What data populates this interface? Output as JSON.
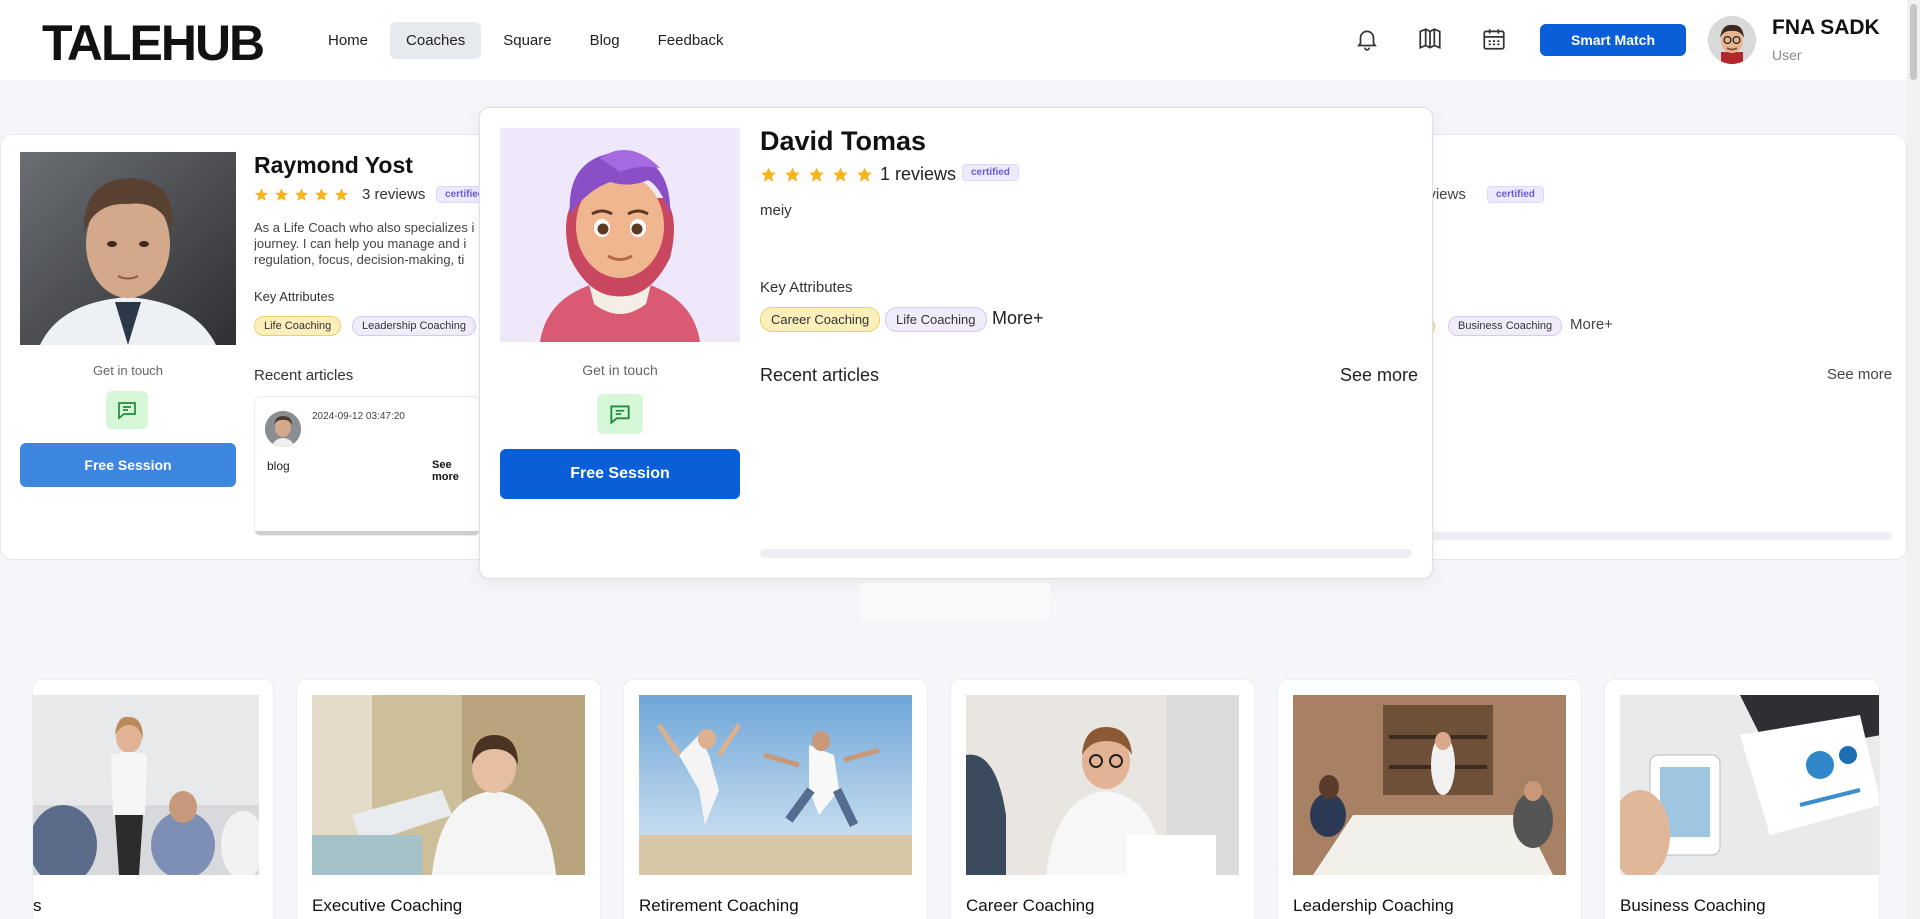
{
  "header": {
    "logo_text": "TALEHUB",
    "nav": [
      {
        "label": "Home"
      },
      {
        "label": "Coaches"
      },
      {
        "label": "Square"
      },
      {
        "label": "Blog"
      },
      {
        "label": "Feedback"
      }
    ],
    "active_nav": "Coaches",
    "icons": [
      "bell-icon",
      "book-icon",
      "calendar-icon"
    ],
    "smart_match_label": "Smart Match",
    "user": {
      "name": "FNA SADK",
      "role": "User"
    }
  },
  "background_coach": {
    "name": "Raymond Yost",
    "rating": 5,
    "reviews": "3 reviews",
    "badge": "certified",
    "description": [
      "As a Life Coach who also specializes i",
      "journey. I can help you manage and i",
      "regulation, focus, decision-making, ti"
    ],
    "key_attributes_label": "Key Attributes",
    "tags": [
      "Life Coaching",
      "Leadership Coaching"
    ],
    "get_in_touch": "Get in touch",
    "free_session_label": "Free Session",
    "recent_articles_label": "Recent articles",
    "article": {
      "date": "2024-09-12 03:47:20",
      "title": "blog",
      "see_more": "See more"
    }
  },
  "right_coach": {
    "reviews": "eviews",
    "badge": "certified",
    "tags": [
      "Business Coaching"
    ],
    "more": "More+",
    "see_more": "See more"
  },
  "popup_coach": {
    "name": "David Tomas",
    "rating": 5,
    "reviews": "1 reviews",
    "badge": "certified",
    "description": "meiy",
    "key_attributes_label": "Key Attributes",
    "tags": [
      "Career Coaching",
      "Life Coaching"
    ],
    "more": "More+",
    "get_in_touch": "Get in touch",
    "free_session_label": "Free Session",
    "recent_articles_label": "Recent articles",
    "see_more": "See more"
  },
  "categories": [
    {
      "title": "s"
    },
    {
      "title": "Executive Coaching"
    },
    {
      "title": "Retirement Coaching"
    },
    {
      "title": "Career Coaching"
    },
    {
      "title": "Leadership Coaching"
    },
    {
      "title": "Business Coaching"
    }
  ],
  "colors": {
    "primary": "#0a5fd8",
    "free_session_bg": "#3d86e0",
    "star": "#f5b31c",
    "badge": "#6a5bd6"
  }
}
